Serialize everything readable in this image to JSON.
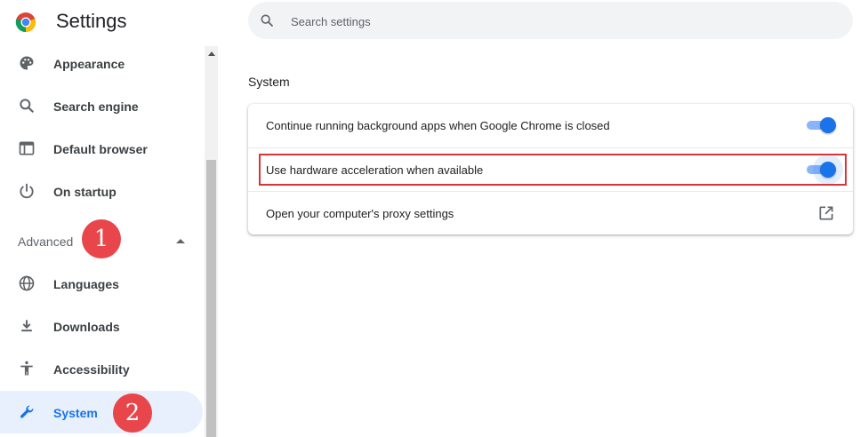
{
  "header": {
    "title": "Settings",
    "logo_icon": "chrome-logo-icon",
    "search": {
      "placeholder": "Search settings",
      "icon": "search-icon"
    }
  },
  "sidebar": {
    "items": [
      {
        "label": "Appearance",
        "icon": "palette-icon"
      },
      {
        "label": "Search engine",
        "icon": "search-icon"
      },
      {
        "label": "Default browser",
        "icon": "browser-window-icon"
      },
      {
        "label": "On startup",
        "icon": "power-icon"
      }
    ],
    "advanced_label": "Advanced",
    "advanced_items": [
      {
        "label": "Languages",
        "icon": "globe-icon"
      },
      {
        "label": "Downloads",
        "icon": "download-icon"
      },
      {
        "label": "Accessibility",
        "icon": "accessibility-icon"
      },
      {
        "label": "System",
        "icon": "wrench-icon",
        "selected": true
      }
    ]
  },
  "annotations": {
    "badge1": "1",
    "badge2": "2",
    "badge_color": "#e8464a"
  },
  "main": {
    "section_title": "System",
    "rows": [
      {
        "label": "Continue running background apps when Google Chrome is closed",
        "type": "toggle",
        "on": true
      },
      {
        "label": "Use hardware acceleration when available",
        "type": "toggle",
        "on": true,
        "highlighted": true
      },
      {
        "label": "Open your computer's proxy settings",
        "type": "external-link",
        "icon": "open-in-new-icon"
      }
    ]
  },
  "colors": {
    "accent": "#1a73e8",
    "selected_bg": "#e8f0fe",
    "highlight_border": "#d9343a"
  }
}
